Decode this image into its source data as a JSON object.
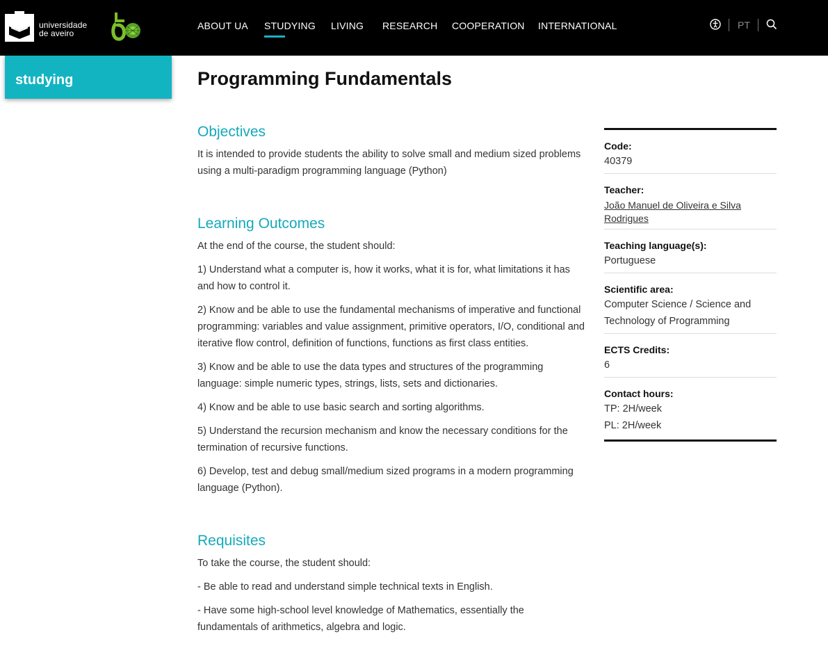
{
  "header": {
    "brand_line1": "universidade",
    "brand_line2": "de aveiro",
    "nav": [
      {
        "label": "ABOUT UA"
      },
      {
        "label": "STUDYING"
      },
      {
        "label": "LIVING"
      },
      {
        "label": "RESEARCH"
      },
      {
        "label": "COOPERATION"
      },
      {
        "label": "INTERNATIONAL"
      }
    ],
    "active_nav": "STUDYING",
    "lang_label": "PT",
    "icons": [
      "accessibility-icon",
      "search-icon"
    ],
    "accent_color": "#13b4c2"
  },
  "sidebar": {
    "section_label": "studying"
  },
  "page": {
    "title": "Programming Fundamentals",
    "objectives": {
      "heading": "Objectives",
      "text": "It is intended to provide students the ability to solve small and medium sized problems using a multi-paradigm programming language (Python)"
    },
    "learning_outcomes": {
      "heading": "Learning Outcomes",
      "intro": "At the end of the course, the student should:",
      "items": [
        "1) Understand what a computer is, how it works, what it is for, what limitations it has and how to control it.",
        "2) Know and be able to use the fundamental mechanisms of imperative and functional programming: variables and value assignment, primitive operators, I/O, conditional and iterative flow control, definition of functions, functions as first class entities.",
        "3) Know and be able to use the data types and structures of the programming language: simple numeric types, strings, lists, sets and dictionaries.",
        "4) Know and be able to use basic search and sorting algorithms.",
        "5) Understand the recursion mechanism and know the necessary conditions for the termination of recursive functions.",
        "6) Develop, test and debug small/medium sized programs in a modern programming language (Python)."
      ]
    },
    "requisites": {
      "heading": "Requisites",
      "intro": "To take the course, the student should:",
      "items": [
        "- Be able to read and understand simple technical texts in English.",
        "- Have some high-school level knowledge of Mathematics, essentially the fundamentals of arithmetics, algebra and logic."
      ]
    }
  },
  "info": {
    "code_label": "Code:",
    "code": "40379",
    "teacher_label": "Teacher:",
    "teacher": "João Manuel de Oliveira e Silva Rodrigues",
    "language_label": "Teaching language(s):",
    "language": "Portuguese",
    "area_label": "Scientific area:",
    "area": "Computer Science / Science and Technology of Programming",
    "ects_label": "ECTS Credits:",
    "ects": "6",
    "hours_label": "Contact hours:",
    "hours_tp": "TP: 2H/week",
    "hours_pl": "PL: 2H/week"
  }
}
